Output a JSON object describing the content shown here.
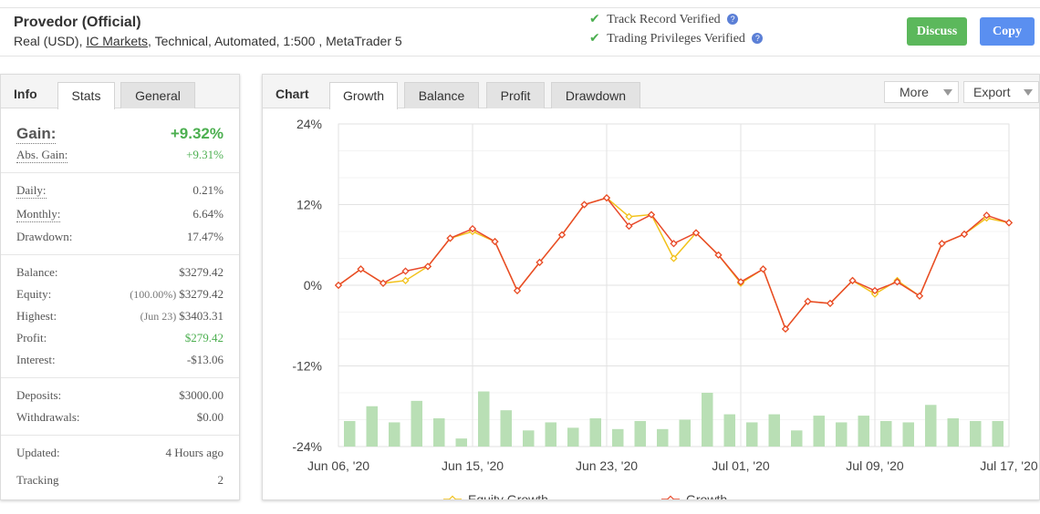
{
  "header": {
    "title": "Provedor (Official)",
    "meta_prefix": "Real (USD), ",
    "broker": "IC Markets",
    "meta_suffix": ", Technical, Automated, 1:500 , MetaTrader 5",
    "verify_track": "Track Record Verified",
    "verify_trading": "Trading Privileges Verified",
    "discuss_label": "Discuss",
    "copy_label": "Copy"
  },
  "info_panel": {
    "title": "Info",
    "tabs": [
      "Stats",
      "General"
    ],
    "gain_label": "Gain:",
    "gain_value": "+9.32%",
    "abs_gain_label": "Abs. Gain:",
    "abs_gain_value": "+9.31%",
    "daily_label": "Daily:",
    "daily_value": "0.21%",
    "monthly_label": "Monthly:",
    "monthly_value": "6.64%",
    "drawdown_label": "Drawdown:",
    "drawdown_value": "17.47%",
    "balance_label": "Balance:",
    "balance_value": "$3279.42",
    "equity_label": "Equity:",
    "equity_pct": "(100.00%)",
    "equity_value": "$3279.42",
    "highest_label": "Highest:",
    "highest_date": "(Jun 23)",
    "highest_value": "$3403.31",
    "profit_label": "Profit:",
    "profit_value": "$279.42",
    "interest_label": "Interest:",
    "interest_value": "-$13.06",
    "deposits_label": "Deposits:",
    "deposits_value": "$3000.00",
    "withdrawals_label": "Withdrawals:",
    "withdrawals_value": "$0.00",
    "updated_label": "Updated:",
    "updated_value": "4 Hours ago",
    "tracking_label": "Tracking",
    "tracking_value": "2"
  },
  "chart_panel": {
    "title": "Chart",
    "tabs": [
      "Growth",
      "Balance",
      "Profit",
      "Drawdown"
    ],
    "more_label": "More",
    "export_label": "Export"
  },
  "colors": {
    "growth": "#e8492b",
    "equity": "#f2c21b",
    "bars": "#b9dfb5",
    "positive": "#4caf50",
    "discuss": "#5cb85c",
    "copy": "#5a8ff0"
  },
  "chart_data": {
    "type": "line",
    "y_ticks": [
      "24%",
      "12%",
      "0%",
      "-12%",
      "-24%"
    ],
    "ylim": [
      -24,
      24
    ],
    "x_tick_labels": [
      "Jun 06, '20",
      "Jun 15, '20",
      "Jun 23, '20",
      "Jul 01, '20",
      "Jul 09, '20",
      "Jul 17, '20"
    ],
    "x_tick_index": [
      0,
      6,
      12,
      18,
      24,
      30
    ],
    "grid": true,
    "legend_position": "bottom",
    "series": [
      {
        "name": "Equity Growth",
        "values": [
          0,
          2.4,
          0.3,
          0.7,
          2.8,
          7.0,
          8.0,
          6.5,
          -0.8,
          3.4,
          7.5,
          12.0,
          13.0,
          10.2,
          10.5,
          4.0,
          7.8,
          4.5,
          0.3,
          2.4,
          -6.5,
          -2.4,
          -2.7,
          0.7,
          -1.3,
          0.7,
          -1.6,
          6.2,
          7.6,
          10.0,
          9.3
        ]
      },
      {
        "name": "Growth",
        "values": [
          0,
          2.4,
          0.3,
          2.1,
          2.8,
          7.0,
          8.4,
          6.5,
          -0.8,
          3.4,
          7.5,
          12.0,
          13.0,
          8.8,
          10.5,
          6.2,
          7.8,
          4.5,
          0.5,
          2.4,
          -6.5,
          -2.4,
          -2.7,
          0.7,
          -0.8,
          0.5,
          -1.6,
          6.2,
          7.6,
          10.4,
          9.3
        ]
      }
    ],
    "volume_bars": [
      3.8,
      6.0,
      3.6,
      6.8,
      4.2,
      1.2,
      8.2,
      5.4,
      2.4,
      3.6,
      2.8,
      4.2,
      2.6,
      3.8,
      2.6,
      4.0,
      8.0,
      4.8,
      3.6,
      4.8,
      2.4,
      4.6,
      3.6,
      4.6,
      3.8,
      3.6,
      6.2,
      4.2,
      3.8,
      3.8
    ]
  }
}
